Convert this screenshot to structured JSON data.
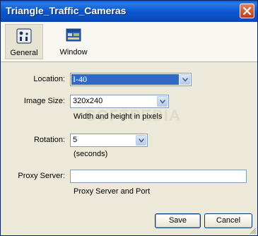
{
  "window": {
    "title": "Triangle_Traffic_Cameras"
  },
  "toolbar": {
    "items": [
      {
        "label": "General",
        "icon": "settings-panel-icon",
        "active": true
      },
      {
        "label": "Window",
        "icon": "window-icon",
        "active": false
      }
    ]
  },
  "form": {
    "location": {
      "label": "Location:",
      "value": "I-40"
    },
    "image_size": {
      "label": "Image Size:",
      "value": "320x240",
      "hint": "Width and height in pixels"
    },
    "rotation": {
      "label": "Rotation:",
      "value": "5",
      "hint": "(seconds)"
    },
    "proxy": {
      "label": "Proxy Server:",
      "value": "",
      "hint": "Proxy Server and Port"
    }
  },
  "buttons": {
    "save": "Save",
    "cancel": "Cancel"
  },
  "colors": {
    "title_bar": "#0b58d0",
    "selection": "#316ac5",
    "dialog_bg": "#ece9d8"
  }
}
